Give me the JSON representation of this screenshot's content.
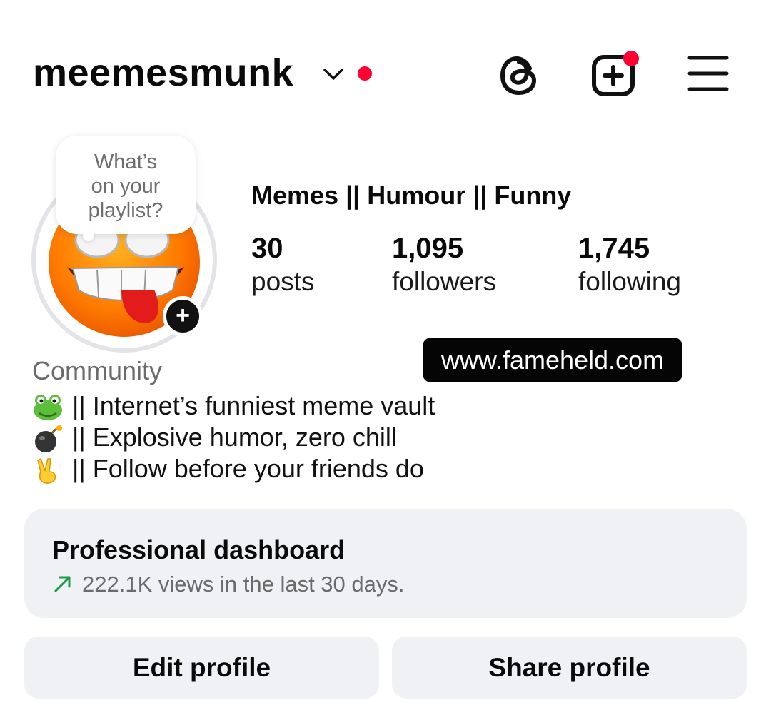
{
  "header": {
    "username": "meemesmunk",
    "icons": {
      "switcher": "chevron-down-icon",
      "threads": "threads-icon",
      "create": "new-post-icon",
      "menu": "hamburger-menu-icon"
    },
    "notification_color": "#ff0033"
  },
  "note": {
    "text_line1": "What’s",
    "text_line2": "on your",
    "text_line3": "playlist?"
  },
  "profile": {
    "display_name": "Memes || Humour || Funny",
    "stats": [
      {
        "value": "30",
        "label": "posts"
      },
      {
        "value": "1,095",
        "label": "followers"
      },
      {
        "value": "1,745",
        "label": "following"
      }
    ],
    "category": "Community",
    "bio_lines": [
      {
        "emoji": "frog-emoji",
        "text": "|| Internet’s funniest meme vault"
      },
      {
        "emoji": "bomb-emoji",
        "text": "|| Explosive humor, zero chill"
      },
      {
        "emoji": "victory-hand-emoji",
        "text": "|| Follow before your friends do"
      }
    ],
    "watermark": "www.fameheld.com"
  },
  "dashboard": {
    "title": "Professional dashboard",
    "subtitle": "222.1K views in the last 30 days.",
    "trend_color": "#1a9a4a"
  },
  "actions": {
    "edit": "Edit profile",
    "share": "Share profile"
  }
}
